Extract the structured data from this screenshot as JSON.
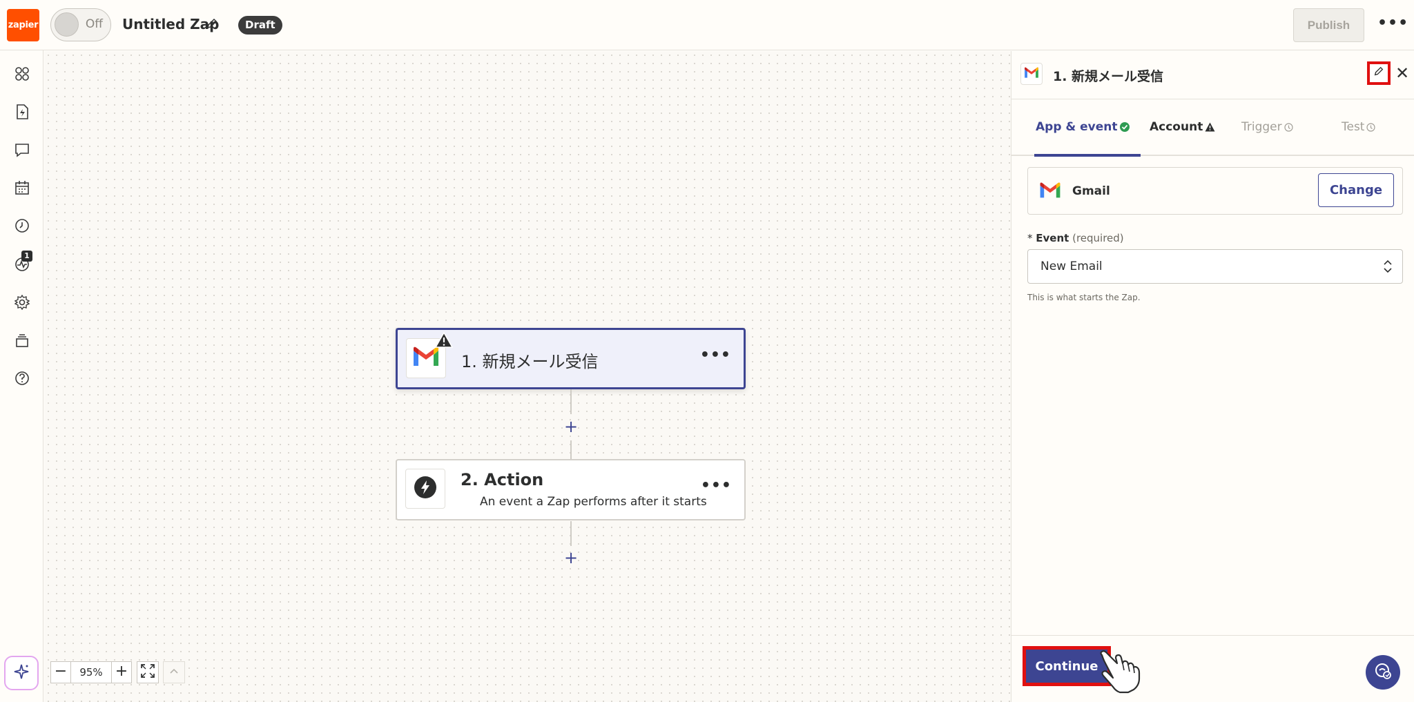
{
  "header": {
    "logo_text": "zapier",
    "toggle_label": "Off",
    "zap_title": "Untitled Zap",
    "status_badge": "Draft",
    "publish_label": "Publish",
    "more_label": "•••"
  },
  "sidebar": {
    "items": [
      {
        "icon": "apps-grid-icon"
      },
      {
        "icon": "zap-file-icon"
      },
      {
        "icon": "chat-icon"
      },
      {
        "icon": "calendar-icon"
      },
      {
        "icon": "history-icon"
      },
      {
        "icon": "activity-icon",
        "badge": "1"
      },
      {
        "icon": "settings-icon"
      },
      {
        "icon": "layers-icon"
      },
      {
        "icon": "help-icon"
      }
    ],
    "ai_button_icon": "sparkle-icon"
  },
  "canvas": {
    "steps": [
      {
        "title": "1. 新規メール受信",
        "app_icon": "gmail-icon",
        "warning": true,
        "more": "•••"
      },
      {
        "title": "2. Action",
        "subtitle": "An event a Zap performs after it starts",
        "app_icon": "bolt-icon",
        "more": "•••"
      }
    ],
    "add_step_label": "+",
    "zoom": {
      "minus": "−",
      "value": "95%",
      "plus": "+"
    }
  },
  "panel": {
    "title": "1. 新規メール受信",
    "tabs": [
      {
        "label": "App & event",
        "status": "complete"
      },
      {
        "label": "Account",
        "status": "warning"
      },
      {
        "label": "Trigger",
        "status": "pending"
      },
      {
        "label": "Test",
        "status": "pending"
      }
    ],
    "app_name": "Gmail",
    "change_label": "Change",
    "event_label": "Event",
    "event_required": "(required)",
    "event_required_mark": "*",
    "event_value": "New Email",
    "event_help": "This is what starts the Zap.",
    "continue_label": "Continue"
  },
  "colors": {
    "brand_orange": "#ff4f00",
    "accent_indigo": "#3d4592",
    "highlight_red": "#e01010",
    "success_green": "#2e9b52"
  }
}
